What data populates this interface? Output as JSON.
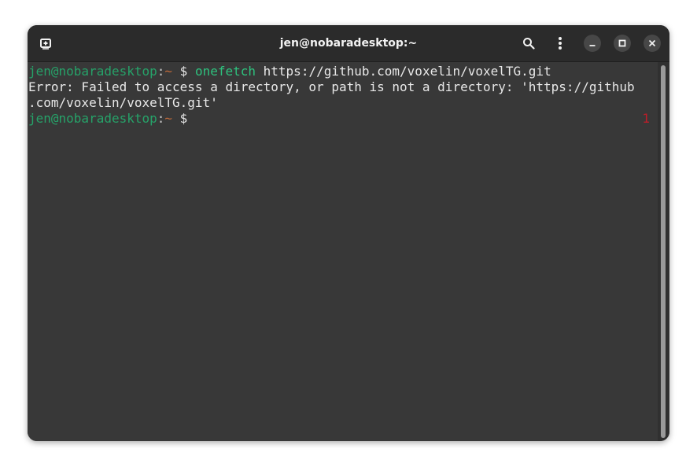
{
  "window": {
    "title": "jen@nobaradesktop:~"
  },
  "header_icons": {
    "new_tab": "new-tab-icon",
    "search": "search-icon",
    "menu": "kebab-menu-icon",
    "minimize": "minimize-icon",
    "maximize": "maximize-icon",
    "close": "close-icon"
  },
  "terminal": {
    "prompt_user": "jen@nobaradesktop",
    "prompt_sep": ":",
    "prompt_dir": "~",
    "prompt_sign": " $ ",
    "command": "onefetch",
    "argument": " https://github.com/voxelin/voxelTG.git",
    "error_line_1": "Error: Failed to access a directory, or path is not a directory: 'https://github",
    "error_line_2": ".com/voxelin/voxelTG.git'",
    "exit_status": "1"
  },
  "colors": {
    "background": "#383838",
    "titlebar": "#2b2b2b",
    "prompt_user": "#26a269",
    "prompt_dir": "#c06a3a",
    "command": "#2ec27e",
    "exit_status": "#c01c28"
  }
}
